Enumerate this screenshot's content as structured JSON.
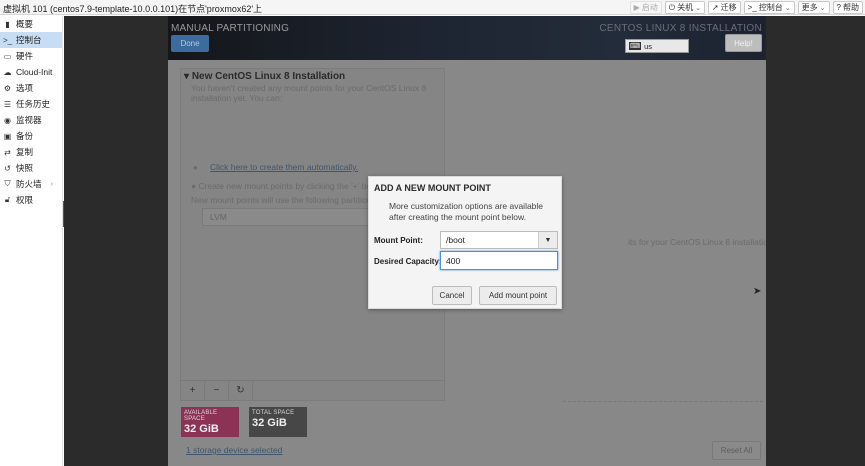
{
  "topbar": {
    "vm_title": "虚拟机 101 (centos7.9-template-10.0.0.101)在节点'proxmox62'上",
    "buttons": [
      {
        "icon": "play-icon",
        "label": "启动"
      },
      {
        "icon": "power-icon",
        "label": "关机"
      },
      {
        "icon": "send-icon",
        "label": "迁移"
      },
      {
        "icon": "terminal-icon",
        "label": "控制台"
      },
      {
        "label": "更多"
      },
      {
        "icon": "help-icon",
        "label": "帮助"
      }
    ]
  },
  "sidebar": {
    "items": [
      {
        "icon": "book-icon",
        "label": "概要"
      },
      {
        "icon": "terminal-icon",
        "label": "控制台"
      },
      {
        "icon": "monitor-icon",
        "label": "硬件"
      },
      {
        "icon": "cloud-icon",
        "label": "Cloud-Init"
      },
      {
        "icon": "gear-icon",
        "label": "选项"
      },
      {
        "icon": "list-icon",
        "label": "任务历史"
      },
      {
        "icon": "eye-icon",
        "label": "监视器"
      },
      {
        "icon": "floppy-icon",
        "label": "备份"
      },
      {
        "icon": "retweet-icon",
        "label": "复制"
      },
      {
        "icon": "history-icon",
        "label": "快照"
      },
      {
        "icon": "shield-icon",
        "label": "防火墙"
      },
      {
        "icon": "unlock-icon",
        "label": "权限"
      }
    ]
  },
  "installer": {
    "header_title": "MANUAL PARTITIONING",
    "header_right": "CENTOS LINUX 8 INSTALLATION",
    "done_label": "Done",
    "keyboard_layout": "us",
    "help_label": "Help!",
    "section_title": "New CentOS Linux 8 Installation",
    "intro_text": "You haven't created any mount points for your CentOS Linux 8 installation yet.  You can:",
    "auto_link": "Click here to create them automatically.",
    "manual_text": "Create new mount points by clicking the '+' button.",
    "scheme_text": "New mount points will use the following partitioning scheme:",
    "scheme_value": "LVM",
    "right_text": "its for your CentOS Linux 8 installation, you'll be able",
    "available_label": "AVAILABLE SPACE",
    "available_value": "32 GiB",
    "total_label": "TOTAL SPACE",
    "total_value": "32 GiB",
    "storage_link": "1 storage device selected",
    "reset_label": "Reset All"
  },
  "dialog": {
    "title": "ADD A NEW MOUNT POINT",
    "description": "More customization options are available after creating the mount point below.",
    "mount_point_label": "Mount Point:",
    "mount_point_value": "/boot",
    "capacity_label": "Desired Capacity:",
    "capacity_value": "400",
    "cancel_label": "Cancel",
    "add_label": "Add mount point"
  }
}
